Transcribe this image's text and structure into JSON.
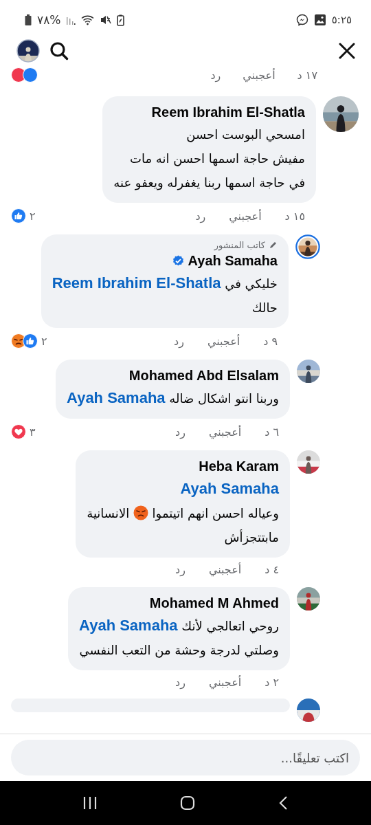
{
  "status_bar": {
    "time": "٥:٢٥",
    "battery": "%٧٨"
  },
  "previous_comment": {
    "time": "١٧ د",
    "like": "أعجبني",
    "reply": "رد",
    "reactions": [
      {
        "kind": "love"
      },
      {
        "kind": "like"
      }
    ]
  },
  "comments": [
    {
      "kind": "comment",
      "author": "Reem Ibrahim El-Shatla",
      "verified": false,
      "story_ring": false,
      "lines": [
        [
          {
            "kind": "text",
            "text": "امسحي البوست احسن"
          }
        ],
        [
          {
            "kind": "text",
            "text": "مفيش حاجة اسمها احسن انه مات"
          }
        ],
        [
          {
            "kind": "text",
            "text": "في حاجة اسمها ربنا يغفرله ويعفو عنه"
          }
        ]
      ],
      "time": "١٥ د",
      "like": "أعجبني",
      "reply": "رد",
      "reactions": [
        {
          "kind": "like"
        }
      ],
      "reaction_count": "٢"
    },
    {
      "kind": "reply",
      "badge": "كاتب المنشور",
      "author": "Ayah Samaha",
      "verified": true,
      "story_ring": true,
      "lines": [
        [
          {
            "kind": "text",
            "text": "خليكي في "
          },
          {
            "kind": "mention",
            "text": "Reem Ibrahim El-Shatla"
          }
        ],
        [
          {
            "kind": "text",
            "text": "حالك"
          }
        ]
      ],
      "time": "٩ د",
      "like": "أعجبني",
      "reply": "رد",
      "reactions": [
        {
          "kind": "angry"
        },
        {
          "kind": "like"
        }
      ],
      "reaction_count": "٢"
    },
    {
      "kind": "reply",
      "author": "Mohamed Abd Elsalam",
      "verified": false,
      "story_ring": false,
      "lines": [
        [
          {
            "kind": "text",
            "text": "وربنا انتو اشكال ضاله "
          },
          {
            "kind": "mention",
            "text": "Ayah Samaha"
          }
        ]
      ],
      "time": "٦ د",
      "like": "أعجبني",
      "reply": "رد",
      "reactions": [
        {
          "kind": "love"
        }
      ],
      "reaction_count": "٣"
    },
    {
      "kind": "reply",
      "author": "Heba Karam",
      "verified": false,
      "story_ring": false,
      "lines": [
        [
          {
            "kind": "mention",
            "text": "Ayah Samaha"
          }
        ],
        [
          {
            "kind": "text",
            "text": "وعياله احسن انهم اتيتموا "
          },
          {
            "kind": "angry_emoji"
          },
          {
            "kind": "text",
            "text": " الانسانية"
          }
        ],
        [
          {
            "kind": "text",
            "text": "مابتتجزأش"
          }
        ]
      ],
      "time": "٤ د",
      "like": "أعجبني",
      "reply": "رد"
    },
    {
      "kind": "reply",
      "author": "Mohamed M Ahmed",
      "verified": false,
      "story_ring": false,
      "lines": [
        [
          {
            "kind": "text",
            "text": "روحي اتعالجي لأنك "
          },
          {
            "kind": "mention",
            "text": "Ayah Samaha"
          }
        ],
        [
          {
            "kind": "text",
            "text": "وصلتي لدرجة وحشة من التعب النفسي"
          }
        ]
      ],
      "time": "٢ د",
      "like": "أعجبني",
      "reply": "رد"
    }
  ],
  "more_below": true,
  "composer": {
    "placeholder": "اكتب تعليقًا..."
  }
}
